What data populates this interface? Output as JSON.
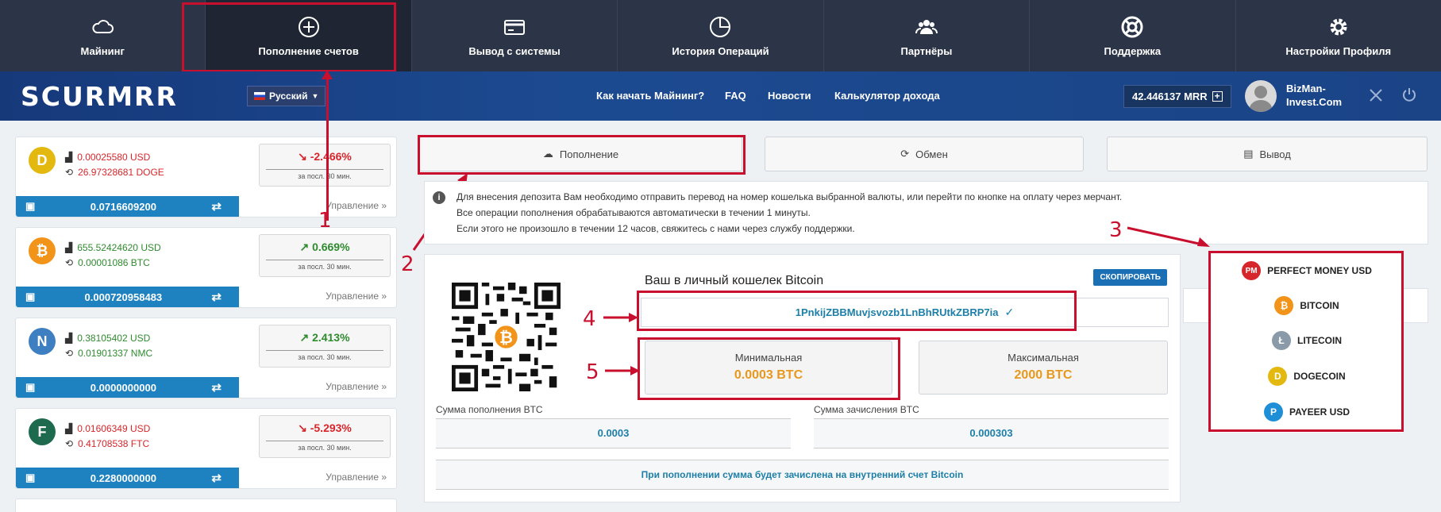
{
  "topnav": [
    {
      "label": "Майнинг",
      "icon": "cloud-icon"
    },
    {
      "label": "Пополнение счетов",
      "icon": "plus-circle-icon"
    },
    {
      "label": "Вывод с системы",
      "icon": "card-icon"
    },
    {
      "label": "История Операций",
      "icon": "chart-pie-icon"
    },
    {
      "label": "Партнёры",
      "icon": "users-icon"
    },
    {
      "label": "Поддержка",
      "icon": "lifebuoy-icon"
    },
    {
      "label": "Настройки Профиля",
      "icon": "gear-icon"
    }
  ],
  "header": {
    "logo": "SCURMRR",
    "language": "Русский",
    "links": [
      "Как начать Майнинг?",
      "FAQ",
      "Новости",
      "Калькулятор дохода"
    ],
    "balance": "42.446137 MRR",
    "username": "BizMan-Invest.Com"
  },
  "coins": [
    {
      "usd": "0.00025580 USD",
      "amount": "26.97328681 DOGE",
      "change": "-2.466%",
      "period": "за посл. 30 мин.",
      "wallet": "0.0716609200",
      "manage": "Управление »",
      "color": "#e3b80f",
      "symbol": "D",
      "trend": "down"
    },
    {
      "usd": "655.52424620 USD",
      "amount": "0.00001086 BTC",
      "change": "0.669%",
      "period": "за посл. 30 мин.",
      "wallet": "0.000720958483",
      "manage": "Управление »",
      "color": "#f2931a",
      "symbol": "₿",
      "trend": "up"
    },
    {
      "usd": "0.38105402 USD",
      "amount": "0.01901337 NMC",
      "change": "2.413%",
      "period": "за посл. 30 мин.",
      "wallet": "0.0000000000",
      "manage": "Управление »",
      "color": "#3e7fc1",
      "symbol": "N",
      "trend": "up"
    },
    {
      "usd": "0.01606349 USD",
      "amount": "0.41708538 FTC",
      "change": "-5.293%",
      "period": "за посл. 30 мин.",
      "wallet": "0.2280000000",
      "manage": "Управление »",
      "color": "#1e6a4f",
      "symbol": "F",
      "trend": "down"
    }
  ],
  "tabs": {
    "deposit": "Пополнение",
    "exchange": "Обмен",
    "withdraw": "Вывод"
  },
  "info": [
    "Для внесения депозита Вам необходимо отправить перевод на номер кошелька выбранной валюты, или перейти по кнопке на оплату через мерчант.",
    "Все операции пополнения обрабатываются автоматически в течении 1 минуты.",
    "Если этого не произошло в течении 12 часов, свяжитесь с нами через службу поддержки."
  ],
  "deposit": {
    "wallet_title": "Ваш в личный кошелек Bitcoin",
    "copy_button": "СКОПИРОВАТЬ",
    "address": "1PnkijZBBMuvjsvozb1LnBhRUtkZBRP7ia",
    "min_label": "Минимальная",
    "min_value": "0.0003 BTC",
    "max_label": "Максимальная",
    "max_value": "2000 BTC",
    "sum_label": "Сумма пополнения BTC",
    "sum_value": "0.0003",
    "credit_label": "Сумма зачисления BTC",
    "credit_value": "0.000303",
    "note": "При пополнении сумма будет зачислена на внутренний счет Bitcoin"
  },
  "currencies": [
    {
      "label": "PERFECT MONEY USD",
      "symbol": "PM",
      "color": "#d7262b"
    },
    {
      "label": "BITCOIN",
      "symbol": "₿",
      "color": "#f2931a"
    },
    {
      "label": "LITECOIN",
      "symbol": "Ł",
      "color": "#8a9aa8"
    },
    {
      "label": "DOGECOIN",
      "symbol": "D",
      "color": "#e3b80f"
    },
    {
      "label": "PAYEER USD",
      "symbol": "P",
      "color": "#1e8fd6"
    }
  ],
  "annotations": [
    "1",
    "2",
    "3",
    "4",
    "5"
  ],
  "colors": {
    "nav_bg": "#2c3548",
    "accent_red": "#c8102e",
    "wallet_blue": "#1d82bf",
    "orange": "#e8981d"
  }
}
